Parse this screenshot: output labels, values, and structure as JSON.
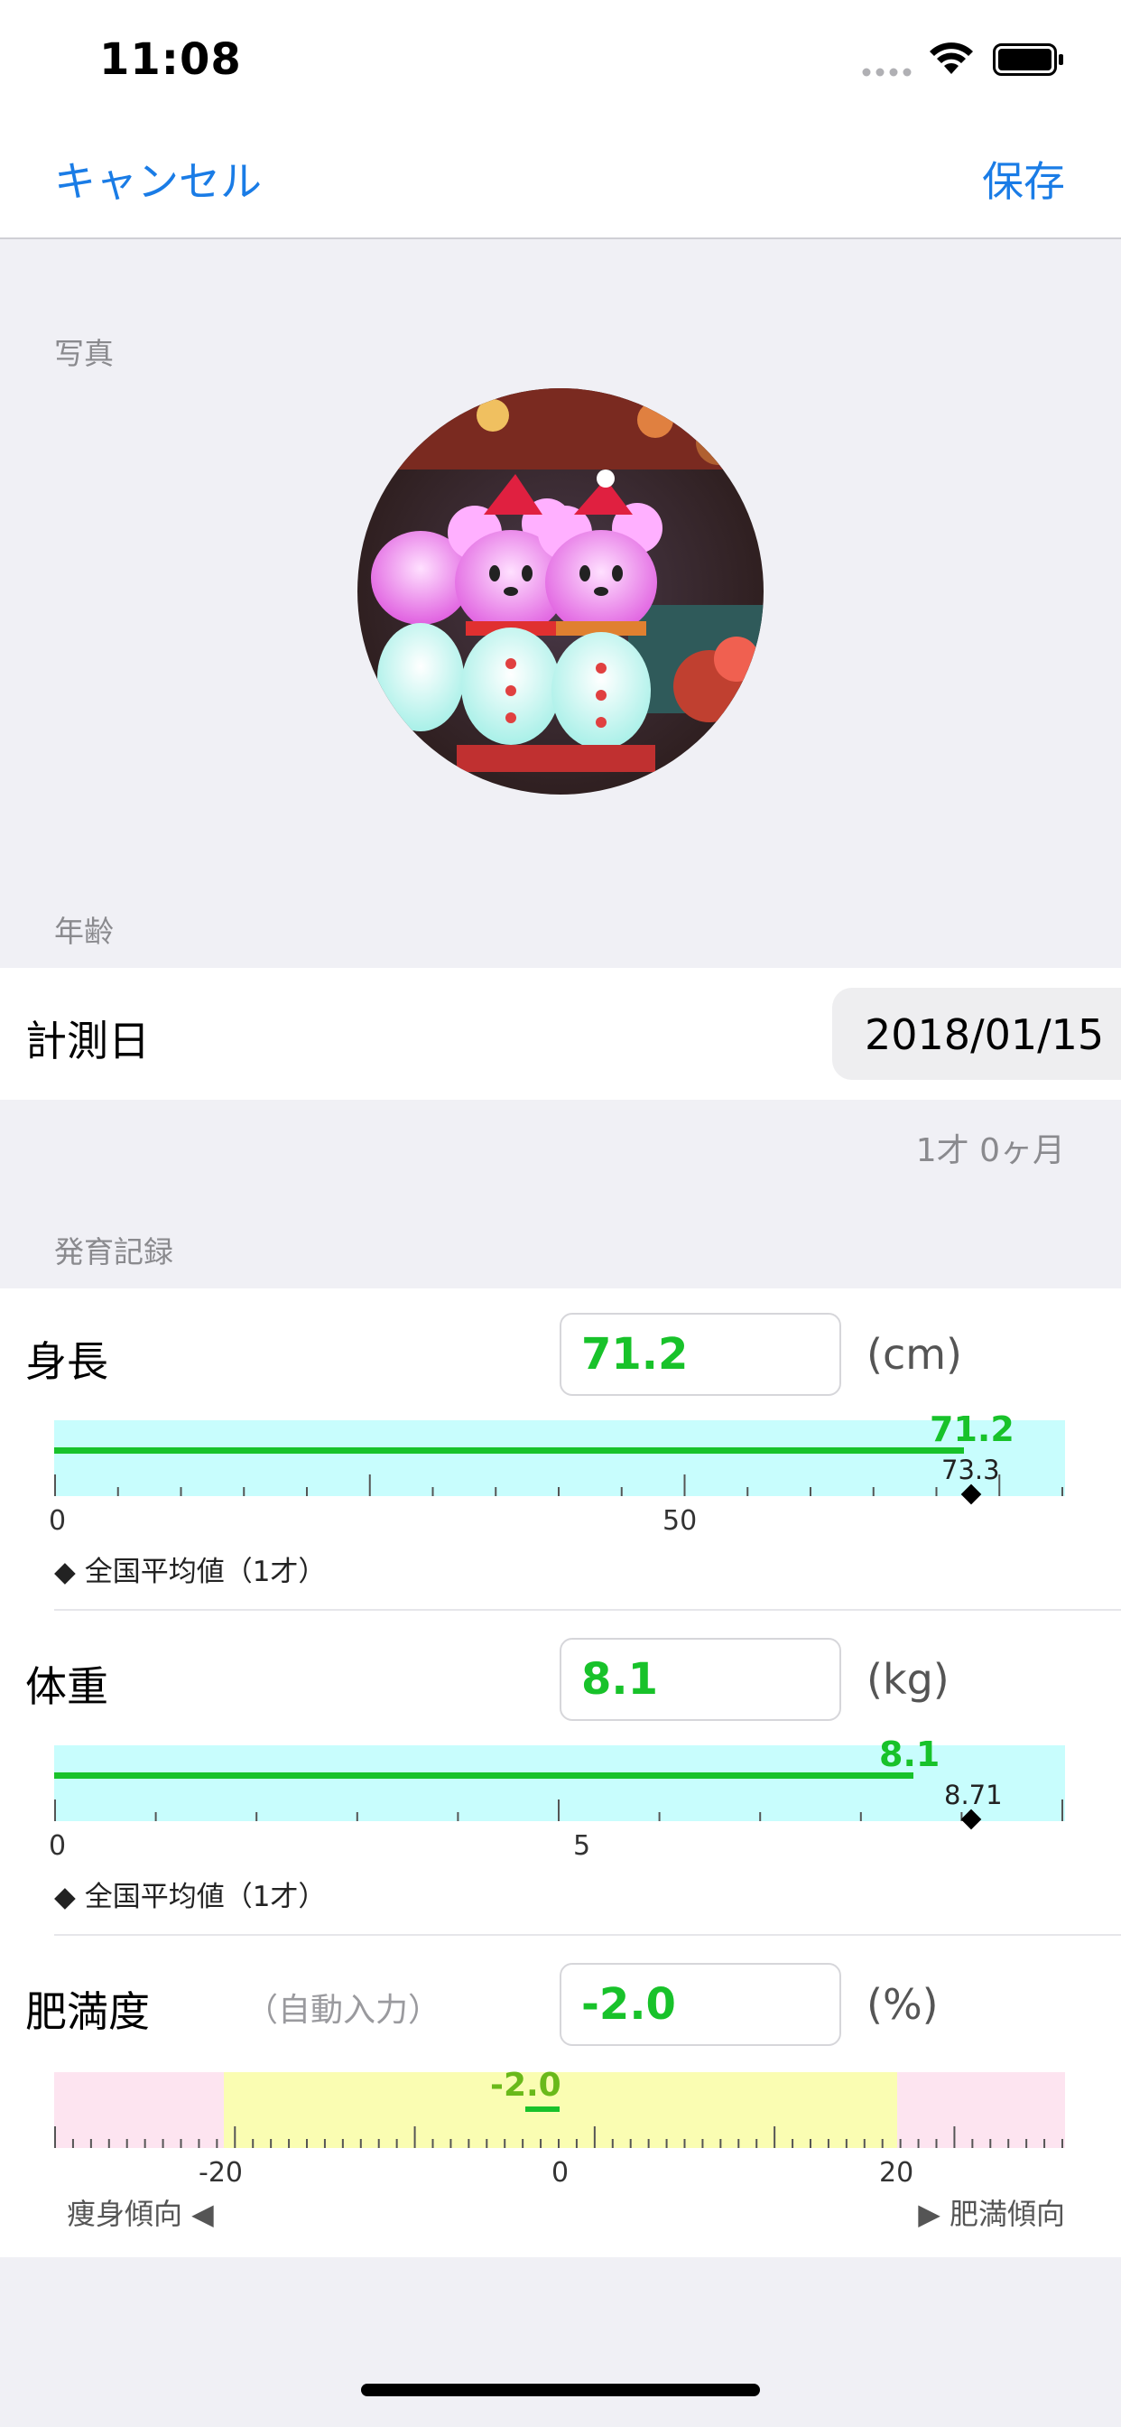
{
  "status_bar": {
    "time": "11:08"
  },
  "nav": {
    "cancel": "キャンセル",
    "save": "保存"
  },
  "photo_section": {
    "title": "写真"
  },
  "age_section": {
    "title": "年齢",
    "date_label": "計測日",
    "date_value": "2018/01/15",
    "age_text": "1才  0ヶ月"
  },
  "growth_section": {
    "title": "発育記録"
  },
  "height": {
    "label": "身長",
    "value": "71.2",
    "unit": "(cm)",
    "marker_value": "71.2",
    "average_value": "73.3",
    "tick_labels": [
      "0",
      "50"
    ],
    "legend": "◆ 全国平均値（1才）",
    "bar_fraction": 0.9
  },
  "weight": {
    "label": "体重",
    "value": "8.1",
    "unit": "(kg)",
    "marker_value": "8.1",
    "average_value": "8.71",
    "tick_labels": [
      "0",
      "5"
    ],
    "legend": "◆ 全国平均値（1才）",
    "bar_fraction": 0.85
  },
  "obesity": {
    "label": "肥満度",
    "hint": "（自動入力）",
    "value": "-2.0",
    "unit": "(%)",
    "marker_value": "-2.0",
    "tick_labels": [
      "-20",
      "0",
      "20"
    ],
    "left_text": "痩身傾向 ◀",
    "right_text": "▶ 肥満傾向"
  },
  "colors": {
    "accent": "#1a7ce6",
    "value_green": "#18c22a",
    "band_cyan": "#c8fdfd",
    "band_pink": "#fde4f0",
    "band_yellow": "#fafdb2"
  }
}
